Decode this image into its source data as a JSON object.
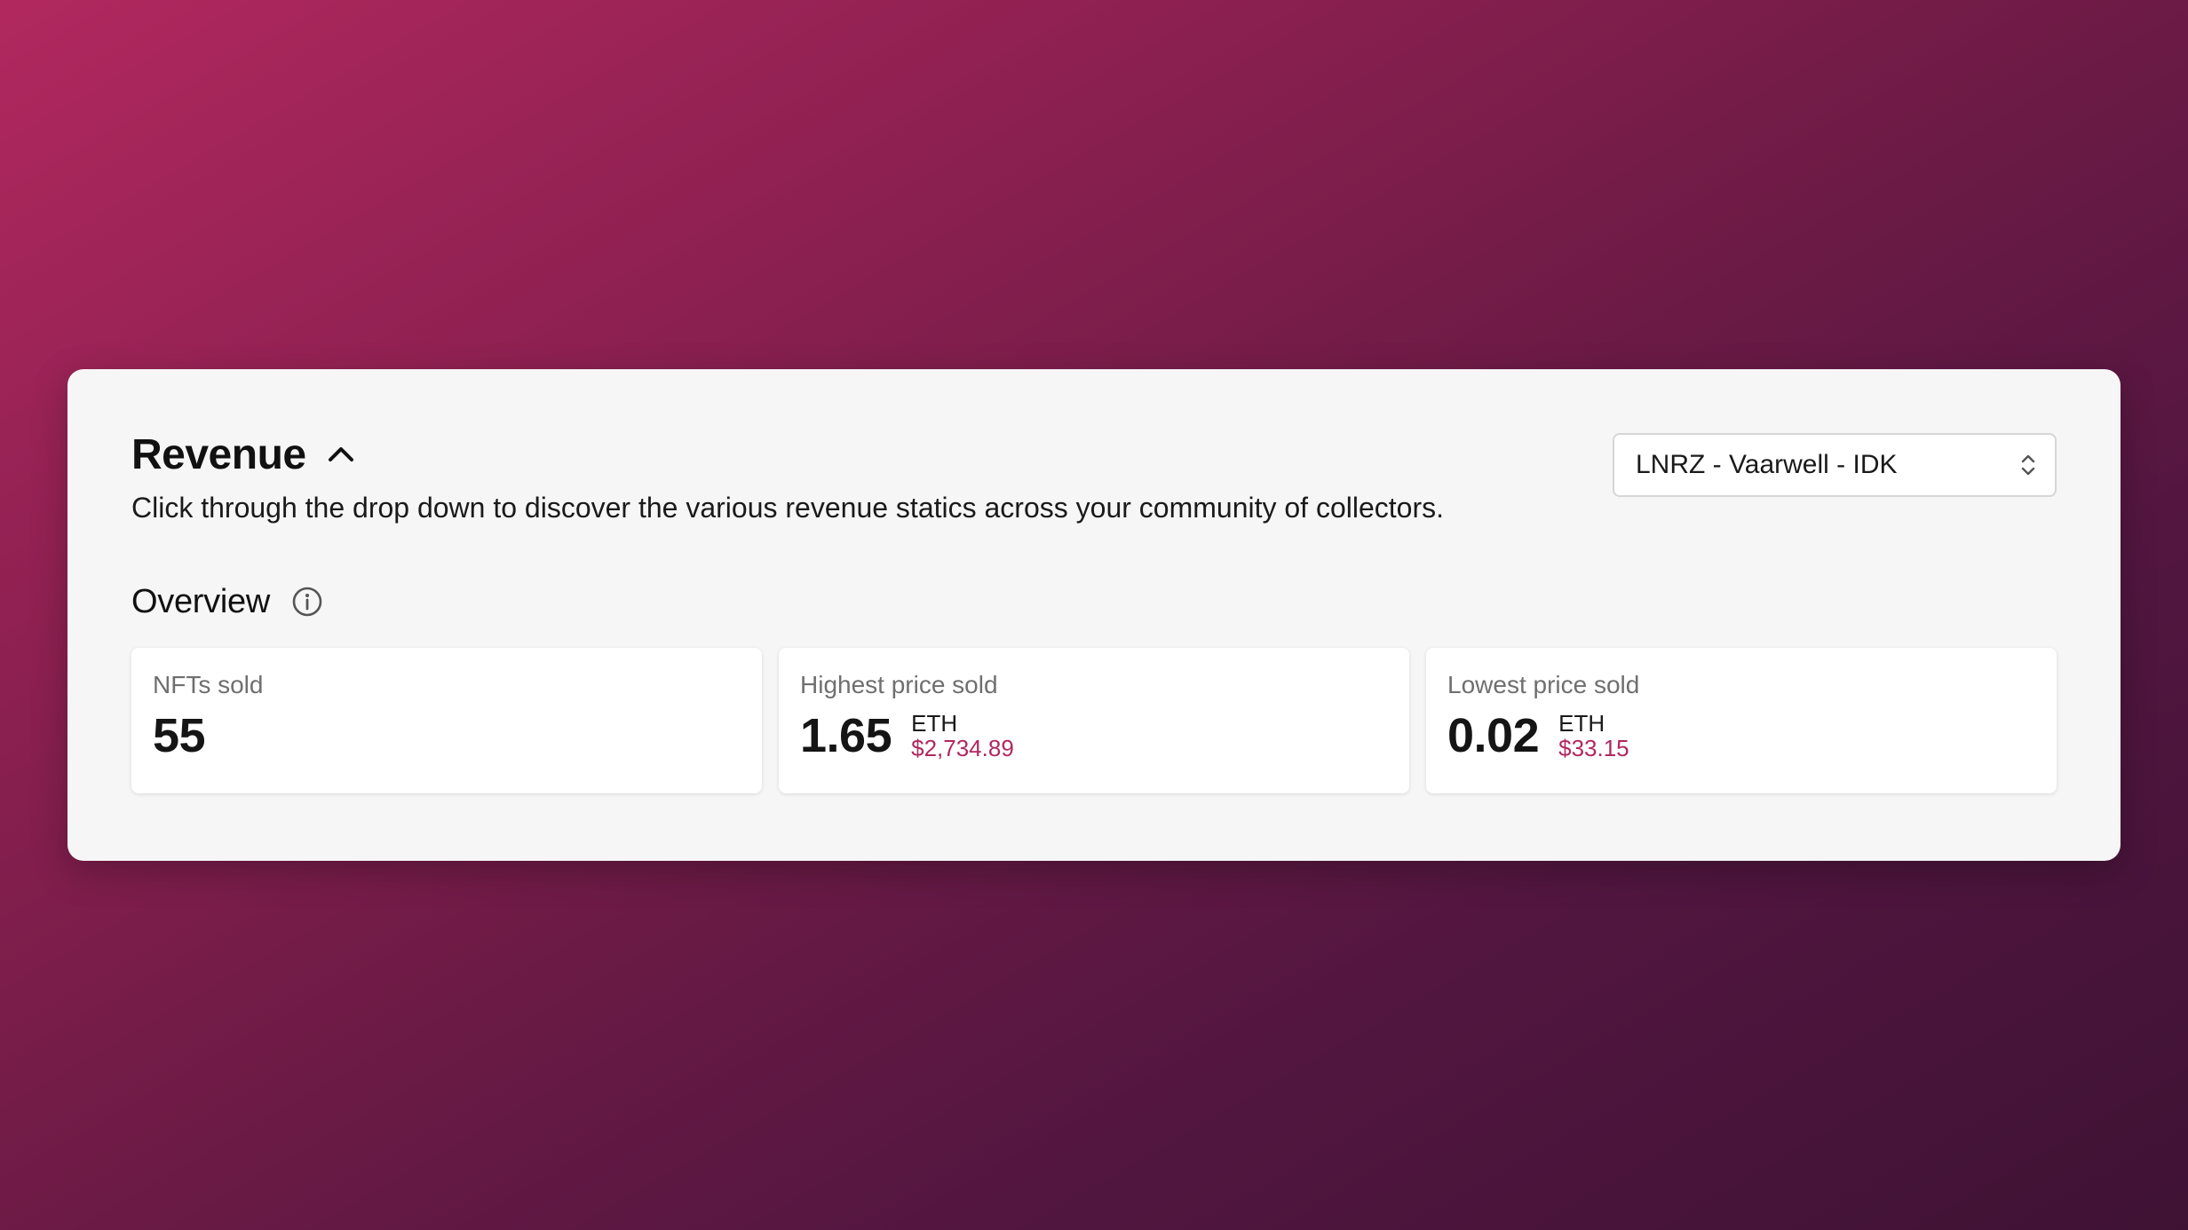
{
  "header": {
    "title": "Revenue",
    "description": "Click through the drop down to discover the various revenue statics across your community of collectors."
  },
  "collection_select": {
    "selected": "LNRZ - Vaarwell - IDK"
  },
  "overview": {
    "title": "Overview",
    "cards": [
      {
        "label": "NFTs sold",
        "value": "55"
      },
      {
        "label": "Highest price sold",
        "value": "1.65",
        "unit": "ETH",
        "usd": "$2,734.89"
      },
      {
        "label": "Lowest price sold",
        "value": "0.02",
        "unit": "ETH",
        "usd": "$33.15"
      }
    ]
  },
  "colors": {
    "accent": "#b0285f",
    "panel_bg": "#f6f6f6",
    "card_bg": "#ffffff"
  },
  "icons": {
    "collapse": "chevron-up-icon",
    "select": "select-arrows-icon",
    "info": "info-icon"
  }
}
